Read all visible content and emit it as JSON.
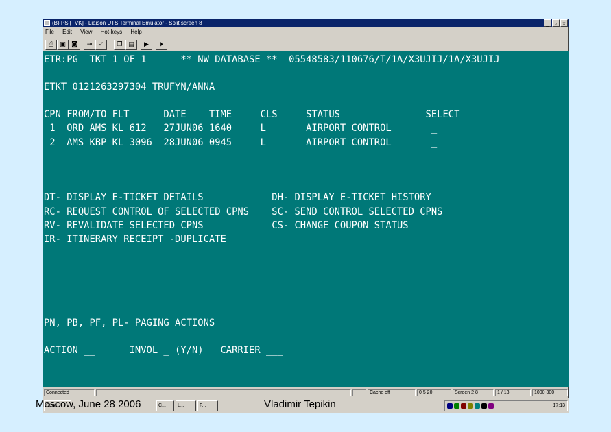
{
  "window": {
    "title": "(B) PS [TVK] - Liaison UTS Terminal Emulator - Split screen 8",
    "buttons": {
      "minimize": "_",
      "maximize": "▫",
      "close": "x"
    }
  },
  "menu": [
    "File",
    "Edit",
    "View",
    "Hot-keys",
    "Help"
  ],
  "toolbar": [
    "print-icon",
    "save-icon",
    "capture-icon",
    "tab-icon",
    "spell-icon",
    "copy-icon",
    "paste-icon",
    "play-icon",
    "step-icon"
  ],
  "terminal": {
    "header": "ETR:PG  TKT 1 OF 1      ** NW DATABASE **  05548583/110676/T/1A/X3UJIJ/1A/X3UJIJ",
    "etkt": "ETKT 0121263297304 TRUFYN/ANNA",
    "coupon_header": "CPN FROM/TO FLT      DATE    TIME     CLS     STATUS               SELECT",
    "coupons": [
      " 1  ORD AMS KL 612   27JUN06 1640     L       AIRPORT CONTROL       _",
      " 2  AMS KBP KL 3096  28JUN06 0945     L       AIRPORT CONTROL       _"
    ],
    "commands": [
      "DT- DISPLAY E-TICKET DETAILS            DH- DISPLAY E-TICKET HISTORY",
      "RC- REQUEST CONTROL OF SELECTED CPNS    SC- SEND CONTROL SELECTED CPNS",
      "RV- REVALIDATE SELECTED CPNS            CS- CHANGE COUPON STATUS",
      "IR- ITINERARY RECEIPT -DUPLICATE"
    ],
    "paging": "PN, PB, PF, PL- PAGING ACTIONS",
    "action_line": "ACTION __      INVOL _ (Y/N)   CARRIER ___"
  },
  "statusbar": {
    "connection": "Connected",
    "cache": "Cache off",
    "cursor": "0 5 20",
    "screen": "Screen 2 8",
    "pos": "1 / 13",
    "extra": "1000 300"
  },
  "taskbar": {
    "tasks": [
      "Start",
      "C...",
      "L...",
      "F..."
    ],
    "clock": "17:13",
    "tray_colors": [
      "#000080",
      "#008000",
      "#800000",
      "#808000",
      "#008080",
      "#000000",
      "#800080"
    ]
  },
  "footer": {
    "left": "Moscow, June 28 2006",
    "center": "Vladimir Tepikin"
  }
}
